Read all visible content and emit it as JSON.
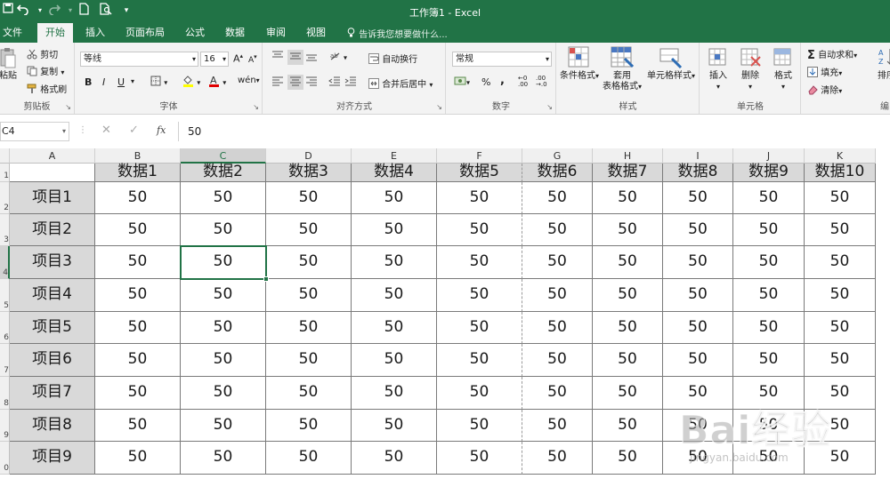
{
  "window": {
    "title": "工作簿1 - Excel"
  },
  "tabs": [
    {
      "label": "文件"
    },
    {
      "label": "开始"
    },
    {
      "label": "插入"
    },
    {
      "label": "页面布局"
    },
    {
      "label": "公式"
    },
    {
      "label": "数据"
    },
    {
      "label": "审阅"
    },
    {
      "label": "视图"
    }
  ],
  "tellme": "告诉我您想要做什么...",
  "clipboard": {
    "paste": "粘贴",
    "cut": "剪切",
    "copy": "复制",
    "painter": "格式刷",
    "label": "剪贴板"
  },
  "font": {
    "name": "等线",
    "size": "16",
    "label": "字体"
  },
  "alignment": {
    "wrap": "自动换行",
    "merge": "合并后居中",
    "label": "对齐方式"
  },
  "number": {
    "format": "常规",
    "percent": "%",
    "comma": ",",
    "label": "数字"
  },
  "styles": {
    "cond": "条件格式",
    "table_l1": "套用",
    "table_l2": "表格格式",
    "cell": "单元格样式",
    "label": "样式"
  },
  "cells": {
    "insert": "插入",
    "delete": "删除",
    "format": "格式",
    "label": "单元格"
  },
  "editing": {
    "autosum": "自动求和",
    "fill": "填充",
    "clear": "清除",
    "sort": "排序",
    "label": "编"
  },
  "formula_bar": {
    "name_box": "C4",
    "value": "50",
    "fx": "fx"
  },
  "sheet": {
    "columns": [
      "A",
      "B",
      "C",
      "D",
      "E",
      "F",
      "G",
      "H",
      "I",
      "J",
      "K"
    ],
    "row_numbers": [
      "1",
      "2",
      "3",
      "4",
      "5",
      "6",
      "7",
      "8",
      "9",
      "0"
    ],
    "header_row": [
      "数据1",
      "数据2",
      "数据3",
      "数据4",
      "数据5",
      "数据6",
      "数据7",
      "数据8",
      "数据9",
      "数据10"
    ],
    "row_labels": [
      "项目1",
      "项目2",
      "项目3",
      "项目4",
      "项目5",
      "项目6",
      "项目7",
      "项目8",
      "项目9"
    ],
    "cell_value": "50",
    "selected_cell": "C4"
  },
  "watermark": {
    "brand": "Bai经验",
    "url": "jingyan.baidu.com"
  },
  "colors": {
    "excel_green": "#217346",
    "header_fill": "#d9d9d9",
    "selection": "#217346"
  }
}
